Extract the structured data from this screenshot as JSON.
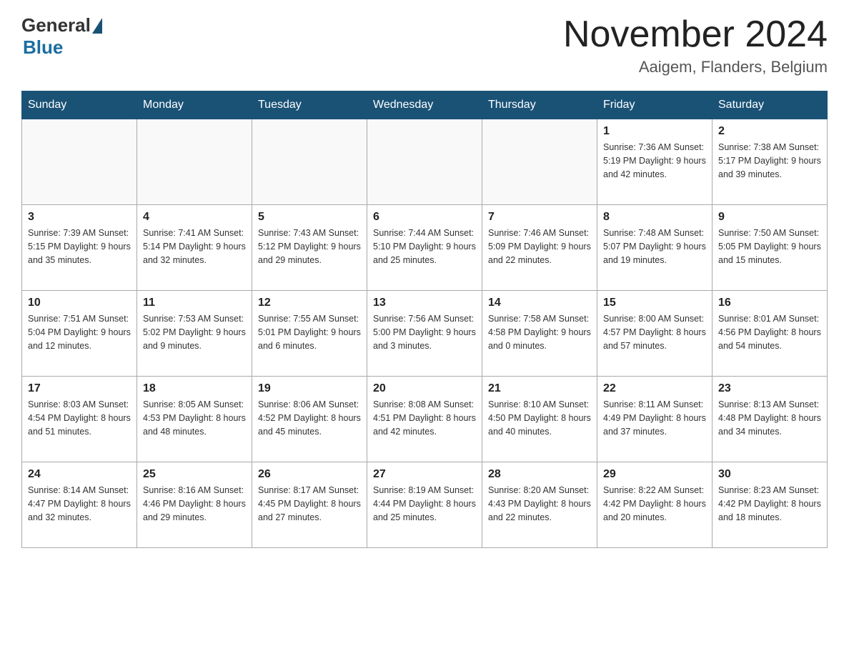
{
  "header": {
    "logo_text_general": "General",
    "logo_text_blue": "Blue",
    "month_year": "November 2024",
    "location": "Aaigem, Flanders, Belgium"
  },
  "days_of_week": [
    "Sunday",
    "Monday",
    "Tuesday",
    "Wednesday",
    "Thursday",
    "Friday",
    "Saturday"
  ],
  "weeks": [
    [
      {
        "day": "",
        "info": ""
      },
      {
        "day": "",
        "info": ""
      },
      {
        "day": "",
        "info": ""
      },
      {
        "day": "",
        "info": ""
      },
      {
        "day": "",
        "info": ""
      },
      {
        "day": "1",
        "info": "Sunrise: 7:36 AM\nSunset: 5:19 PM\nDaylight: 9 hours and 42 minutes."
      },
      {
        "day": "2",
        "info": "Sunrise: 7:38 AM\nSunset: 5:17 PM\nDaylight: 9 hours and 39 minutes."
      }
    ],
    [
      {
        "day": "3",
        "info": "Sunrise: 7:39 AM\nSunset: 5:15 PM\nDaylight: 9 hours and 35 minutes."
      },
      {
        "day": "4",
        "info": "Sunrise: 7:41 AM\nSunset: 5:14 PM\nDaylight: 9 hours and 32 minutes."
      },
      {
        "day": "5",
        "info": "Sunrise: 7:43 AM\nSunset: 5:12 PM\nDaylight: 9 hours and 29 minutes."
      },
      {
        "day": "6",
        "info": "Sunrise: 7:44 AM\nSunset: 5:10 PM\nDaylight: 9 hours and 25 minutes."
      },
      {
        "day": "7",
        "info": "Sunrise: 7:46 AM\nSunset: 5:09 PM\nDaylight: 9 hours and 22 minutes."
      },
      {
        "day": "8",
        "info": "Sunrise: 7:48 AM\nSunset: 5:07 PM\nDaylight: 9 hours and 19 minutes."
      },
      {
        "day": "9",
        "info": "Sunrise: 7:50 AM\nSunset: 5:05 PM\nDaylight: 9 hours and 15 minutes."
      }
    ],
    [
      {
        "day": "10",
        "info": "Sunrise: 7:51 AM\nSunset: 5:04 PM\nDaylight: 9 hours and 12 minutes."
      },
      {
        "day": "11",
        "info": "Sunrise: 7:53 AM\nSunset: 5:02 PM\nDaylight: 9 hours and 9 minutes."
      },
      {
        "day": "12",
        "info": "Sunrise: 7:55 AM\nSunset: 5:01 PM\nDaylight: 9 hours and 6 minutes."
      },
      {
        "day": "13",
        "info": "Sunrise: 7:56 AM\nSunset: 5:00 PM\nDaylight: 9 hours and 3 minutes."
      },
      {
        "day": "14",
        "info": "Sunrise: 7:58 AM\nSunset: 4:58 PM\nDaylight: 9 hours and 0 minutes."
      },
      {
        "day": "15",
        "info": "Sunrise: 8:00 AM\nSunset: 4:57 PM\nDaylight: 8 hours and 57 minutes."
      },
      {
        "day": "16",
        "info": "Sunrise: 8:01 AM\nSunset: 4:56 PM\nDaylight: 8 hours and 54 minutes."
      }
    ],
    [
      {
        "day": "17",
        "info": "Sunrise: 8:03 AM\nSunset: 4:54 PM\nDaylight: 8 hours and 51 minutes."
      },
      {
        "day": "18",
        "info": "Sunrise: 8:05 AM\nSunset: 4:53 PM\nDaylight: 8 hours and 48 minutes."
      },
      {
        "day": "19",
        "info": "Sunrise: 8:06 AM\nSunset: 4:52 PM\nDaylight: 8 hours and 45 minutes."
      },
      {
        "day": "20",
        "info": "Sunrise: 8:08 AM\nSunset: 4:51 PM\nDaylight: 8 hours and 42 minutes."
      },
      {
        "day": "21",
        "info": "Sunrise: 8:10 AM\nSunset: 4:50 PM\nDaylight: 8 hours and 40 minutes."
      },
      {
        "day": "22",
        "info": "Sunrise: 8:11 AM\nSunset: 4:49 PM\nDaylight: 8 hours and 37 minutes."
      },
      {
        "day": "23",
        "info": "Sunrise: 8:13 AM\nSunset: 4:48 PM\nDaylight: 8 hours and 34 minutes."
      }
    ],
    [
      {
        "day": "24",
        "info": "Sunrise: 8:14 AM\nSunset: 4:47 PM\nDaylight: 8 hours and 32 minutes."
      },
      {
        "day": "25",
        "info": "Sunrise: 8:16 AM\nSunset: 4:46 PM\nDaylight: 8 hours and 29 minutes."
      },
      {
        "day": "26",
        "info": "Sunrise: 8:17 AM\nSunset: 4:45 PM\nDaylight: 8 hours and 27 minutes."
      },
      {
        "day": "27",
        "info": "Sunrise: 8:19 AM\nSunset: 4:44 PM\nDaylight: 8 hours and 25 minutes."
      },
      {
        "day": "28",
        "info": "Sunrise: 8:20 AM\nSunset: 4:43 PM\nDaylight: 8 hours and 22 minutes."
      },
      {
        "day": "29",
        "info": "Sunrise: 8:22 AM\nSunset: 4:42 PM\nDaylight: 8 hours and 20 minutes."
      },
      {
        "day": "30",
        "info": "Sunrise: 8:23 AM\nSunset: 4:42 PM\nDaylight: 8 hours and 18 minutes."
      }
    ]
  ]
}
